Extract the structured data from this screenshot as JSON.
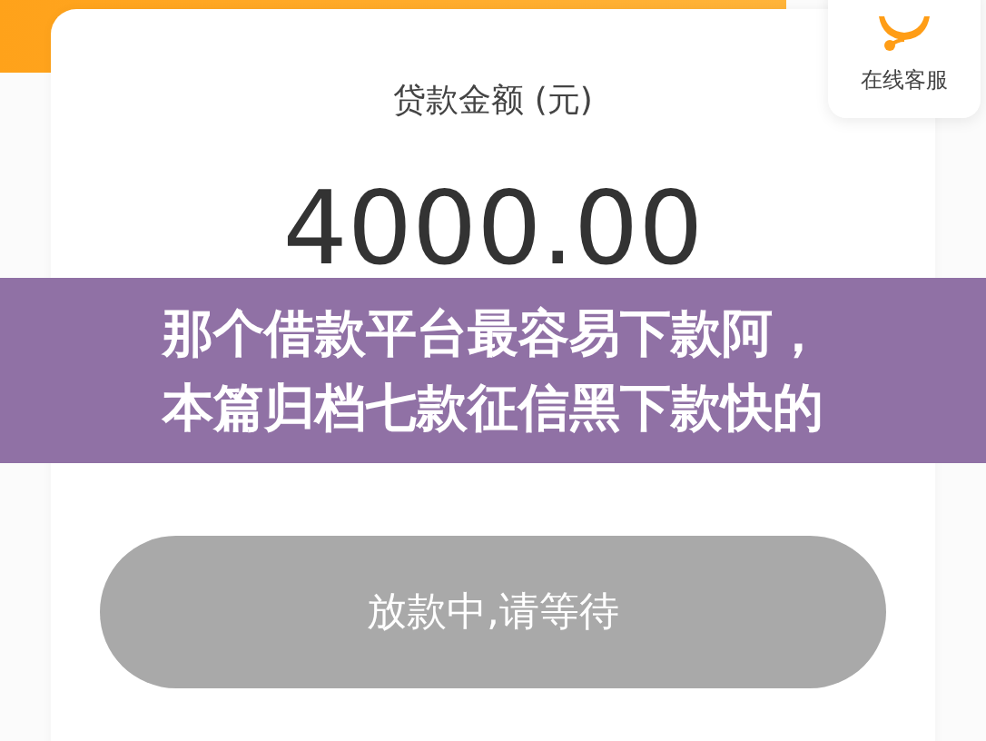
{
  "loan_card": {
    "label": "贷款金额 (元)",
    "amount": "4000.00"
  },
  "action_button": {
    "label": "放款中,请等待",
    "disabled": true
  },
  "customer_service": {
    "label": "在线客服"
  },
  "banner": {
    "lines": [
      "那个借款平台最容易下款阿，",
      "本篇归档七款征信黑下款快的"
    ]
  }
}
